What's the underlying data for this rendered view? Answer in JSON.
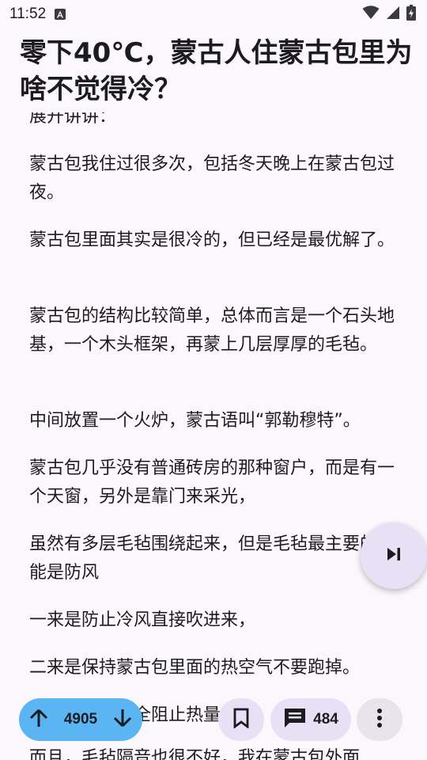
{
  "status_bar": {
    "time": "11:52"
  },
  "article": {
    "title": "零下40℃，蒙古人住蒙古包里为啥不觉得冷？",
    "paragraphs": [
      "展开讲讲：",
      "蒙古包我住过很多次，包括冬天晚上在蒙古包过夜。",
      "蒙古包里面其实是很冷的，但已经是最优解了。",
      "蒙古包的结构比较简单，总体而言是一个石头地基，一个木头框架，再蒙上几层厚厚的毛毡。",
      "中间放置一个火炉，蒙古语叫“郭勒穆特”。",
      "蒙古包几乎没有普通砖房的那种窗户，而是有一个天窗，另外是靠门来采光，",
      "虽然有多层毛毡围绕起来，但是毛毡最主要的功能是防风",
      "一来是防止冷风直接吹进来，",
      "二来是保持蒙古包里面的热空气不要跑掉。",
      "毛毡并不能完全阻止热量散失，",
      "而且，毛毡隔音也很不好，我在蒙古包外面"
    ]
  },
  "actions": {
    "vote_count": "4905",
    "comment_count": "484"
  },
  "colors": {
    "background": "#fbf8fd",
    "vote_pill": "#5bb5f2",
    "tonal_button": "#e8e0f5",
    "text": "#1c1b1f"
  }
}
